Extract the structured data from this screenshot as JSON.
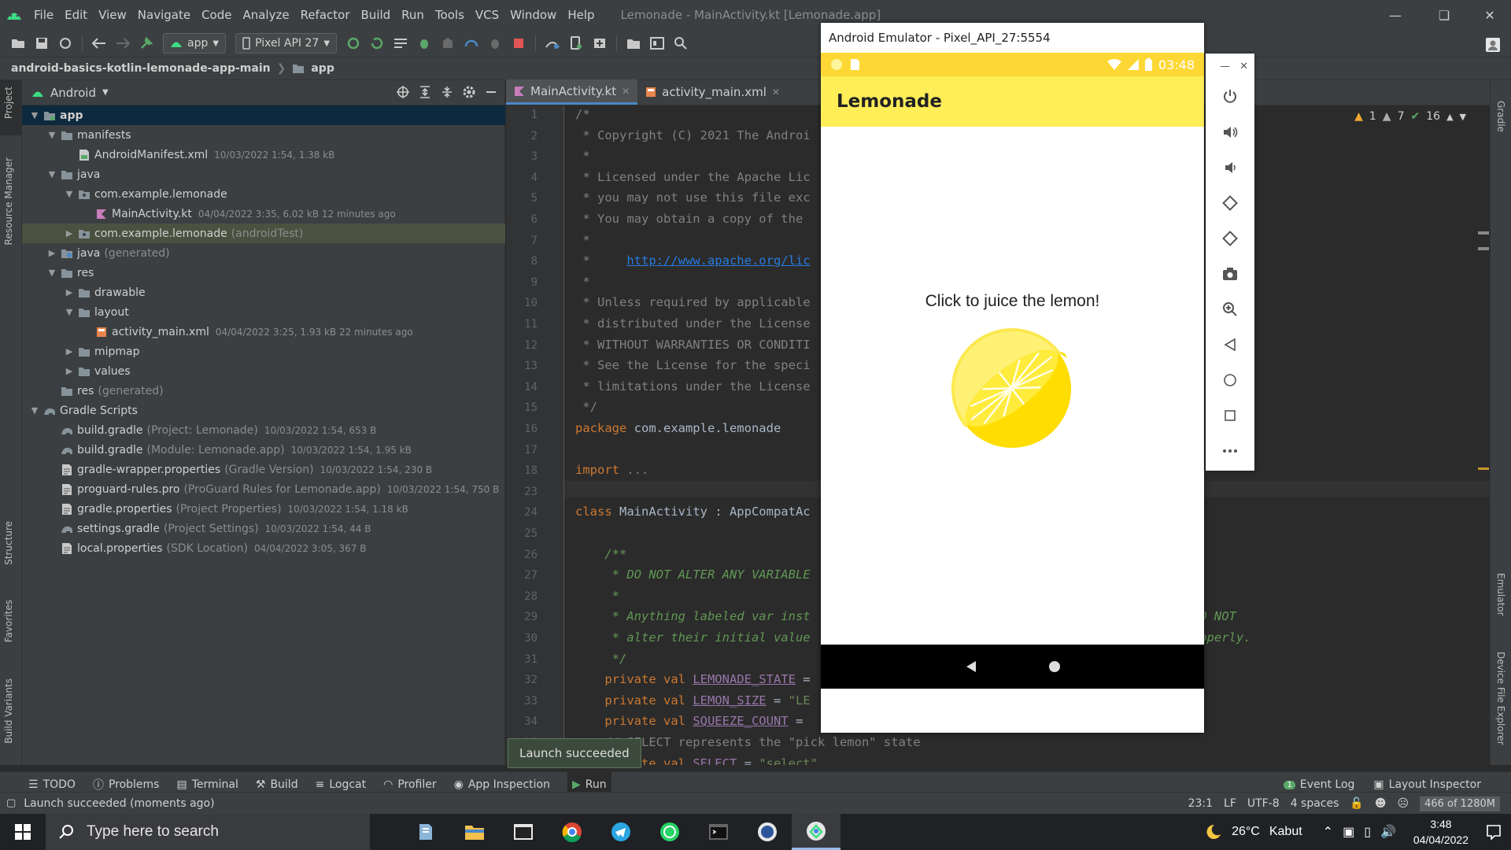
{
  "menubar": {
    "items": [
      "File",
      "Edit",
      "View",
      "Navigate",
      "Code",
      "Analyze",
      "Refactor",
      "Build",
      "Run",
      "Tools",
      "VCS",
      "Window",
      "Help"
    ],
    "window_title": "Lemonade - MainActivity.kt [Lemonade.app]"
  },
  "toolbar": {
    "run_config": "app",
    "device": "Pixel API 27"
  },
  "breadcrumb": {
    "project": "android-basics-kotlin-lemonade-app-main",
    "module": "app"
  },
  "left_strip": {
    "tabs": [
      "Project",
      "Resource Manager",
      "Structure",
      "Favorites",
      "Build Variants"
    ]
  },
  "project_panel": {
    "view": "Android",
    "tree": [
      {
        "depth": 0,
        "arrow": "open",
        "icon": "module-folder-icon",
        "label": "app",
        "bold": true,
        "selected": true
      },
      {
        "depth": 1,
        "arrow": "open",
        "icon": "folder-icon",
        "label": "manifests"
      },
      {
        "depth": 2,
        "arrow": "",
        "icon": "manifest-file-icon",
        "label": "AndroidManifest.xml",
        "meta": "10/03/2022 1:54, 1.38 kB"
      },
      {
        "depth": 1,
        "arrow": "open",
        "icon": "folder-icon",
        "label": "java"
      },
      {
        "depth": 2,
        "arrow": "open",
        "icon": "package-icon",
        "label": "com.example.lemonade"
      },
      {
        "depth": 3,
        "arrow": "",
        "icon": "kotlin-file-icon",
        "label": "MainActivity.kt",
        "meta": "04/04/2022 3:35, 6.02 kB 12 minutes ago"
      },
      {
        "depth": 2,
        "arrow": "closed",
        "icon": "package-icon",
        "label": "com.example.lemonade",
        "gray": "(androidTest)",
        "highlight": true
      },
      {
        "depth": 1,
        "arrow": "closed",
        "icon": "generated-folder-icon",
        "label": "java",
        "gray": "(generated)"
      },
      {
        "depth": 1,
        "arrow": "open",
        "icon": "folder-icon",
        "label": "res"
      },
      {
        "depth": 2,
        "arrow": "closed",
        "icon": "folder-icon",
        "label": "drawable"
      },
      {
        "depth": 2,
        "arrow": "open",
        "icon": "folder-icon",
        "label": "layout"
      },
      {
        "depth": 3,
        "arrow": "",
        "icon": "layout-file-icon",
        "label": "activity_main.xml",
        "meta": "04/04/2022 3:25, 1.93 kB 22 minutes ago"
      },
      {
        "depth": 2,
        "arrow": "closed",
        "icon": "folder-icon",
        "label": "mipmap"
      },
      {
        "depth": 2,
        "arrow": "closed",
        "icon": "folder-icon",
        "label": "values"
      },
      {
        "depth": 1,
        "arrow": "",
        "icon": "folder-icon",
        "label": "res",
        "gray": "(generated)"
      },
      {
        "depth": 0,
        "arrow": "open",
        "icon": "gradle-icon",
        "label": "Gradle Scripts"
      },
      {
        "depth": 1,
        "arrow": "",
        "icon": "gradle-icon",
        "label": "build.gradle",
        "gray": "(Project: Lemonade)",
        "meta": "10/03/2022 1:54, 653 B"
      },
      {
        "depth": 1,
        "arrow": "",
        "icon": "gradle-icon",
        "label": "build.gradle",
        "gray": "(Module: Lemonade.app)",
        "meta": "10/03/2022 1:54, 1.95 kB"
      },
      {
        "depth": 1,
        "arrow": "",
        "icon": "properties-icon",
        "label": "gradle-wrapper.properties",
        "gray": "(Gradle Version)",
        "meta": "10/03/2022 1:54, 230 B"
      },
      {
        "depth": 1,
        "arrow": "",
        "icon": "properties-icon",
        "label": "proguard-rules.pro",
        "gray": "(ProGuard Rules for Lemonade.app)",
        "meta": "10/03/2022 1:54, 750 B"
      },
      {
        "depth": 1,
        "arrow": "",
        "icon": "properties-icon",
        "label": "gradle.properties",
        "gray": "(Project Properties)",
        "meta": "10/03/2022 1:54, 1.18 kB"
      },
      {
        "depth": 1,
        "arrow": "",
        "icon": "gradle-icon",
        "label": "settings.gradle",
        "gray": "(Project Settings)",
        "meta": "10/03/2022 1:54, 44 B"
      },
      {
        "depth": 1,
        "arrow": "",
        "icon": "properties-icon",
        "label": "local.properties",
        "gray": "(SDK Location)",
        "meta": "04/04/2022 3:05, 367 B"
      }
    ]
  },
  "editor": {
    "tabs": [
      {
        "label": "MainActivity.kt",
        "active": true
      },
      {
        "label": "activity_main.xml",
        "active": false
      }
    ],
    "inspection": {
      "warnings": "1",
      "weak_warnings": "7",
      "ok": "16"
    },
    "lines": [
      {
        "n": "1",
        "parts": [
          {
            "t": "/*",
            "c": "cmt"
          }
        ]
      },
      {
        "n": "2",
        "parts": [
          {
            "t": " * Copyright (C) 2021 The Androi",
            "c": "cmt"
          }
        ]
      },
      {
        "n": "3",
        "parts": [
          {
            "t": " *",
            "c": "cmt"
          }
        ]
      },
      {
        "n": "4",
        "parts": [
          {
            "t": " * Licensed under the Apache Lic",
            "c": "cmt"
          }
        ]
      },
      {
        "n": "5",
        "parts": [
          {
            "t": " * you may not use this file exc",
            "c": "cmt"
          }
        ]
      },
      {
        "n": "6",
        "parts": [
          {
            "t": " * You may obtain a copy of the ",
            "c": "cmt"
          }
        ]
      },
      {
        "n": "7",
        "parts": [
          {
            "t": " *",
            "c": "cmt"
          }
        ]
      },
      {
        "n": "8",
        "parts": [
          {
            "t": " *     ",
            "c": "cmt"
          },
          {
            "t": "http://www.apache.org/lic",
            "c": "link"
          }
        ]
      },
      {
        "n": "9",
        "parts": [
          {
            "t": " *",
            "c": "cmt"
          }
        ]
      },
      {
        "n": "10",
        "parts": [
          {
            "t": " * Unless required by applicable",
            "c": "cmt"
          }
        ]
      },
      {
        "n": "11",
        "parts": [
          {
            "t": " * distributed under the License",
            "c": "cmt"
          }
        ]
      },
      {
        "n": "12",
        "parts": [
          {
            "t": " * WITHOUT WARRANTIES OR CONDITI",
            "c": "cmt"
          }
        ]
      },
      {
        "n": "13",
        "parts": [
          {
            "t": " * See the License for the speci",
            "c": "cmt"
          }
        ]
      },
      {
        "n": "14",
        "parts": [
          {
            "t": " * limitations under the License",
            "c": "cmt"
          }
        ]
      },
      {
        "n": "15",
        "parts": [
          {
            "t": " */",
            "c": "cmt"
          }
        ]
      },
      {
        "n": "16",
        "parts": [
          {
            "t": "package ",
            "c": "kw"
          },
          {
            "t": "com.example.lemonade",
            "c": ""
          }
        ]
      },
      {
        "n": "17",
        "parts": []
      },
      {
        "n": "18",
        "parts": [
          {
            "t": "import ",
            "c": "kw"
          },
          {
            "t": "...",
            "c": "cmt"
          }
        ]
      },
      {
        "n": "23",
        "parts": []
      },
      {
        "n": "24",
        "parts": [
          {
            "t": "class ",
            "c": "kw"
          },
          {
            "t": "MainActivity : AppCompatAc",
            "c": ""
          }
        ]
      },
      {
        "n": "25",
        "parts": []
      },
      {
        "n": "26",
        "parts": [
          {
            "t": "    /**",
            "c": "doc"
          }
        ]
      },
      {
        "n": "27",
        "parts": [
          {
            "t": "     * DO NOT ALTER ANY VARIABLE",
            "c": "doc"
          }
        ]
      },
      {
        "n": "28",
        "parts": [
          {
            "t": "     *",
            "c": "doc"
          }
        ]
      },
      {
        "n": "29",
        "parts": [
          {
            "t": "     * Anything labeled var inst",
            "c": "doc"
          },
          {
            "t": "                                          tions but DO NOT",
            "c": "doc"
          }
        ]
      },
      {
        "n": "30",
        "parts": [
          {
            "t": "     * alter their initial value",
            "c": "doc"
          },
          {
            "t": "                                          function properly.",
            "c": "doc"
          }
        ]
      },
      {
        "n": "31",
        "parts": [
          {
            "t": "     */",
            "c": "doc"
          }
        ]
      },
      {
        "n": "32",
        "parts": [
          {
            "t": "    private val ",
            "c": "kw"
          },
          {
            "t": "LEMONADE_STATE",
            "c": "fld"
          },
          {
            "t": " =",
            "c": ""
          }
        ]
      },
      {
        "n": "33",
        "parts": [
          {
            "t": "    private val ",
            "c": "kw"
          },
          {
            "t": "LEMON_SIZE",
            "c": "fld"
          },
          {
            "t": " = ",
            "c": ""
          },
          {
            "t": "\"LE",
            "c": "str"
          }
        ]
      },
      {
        "n": "34",
        "parts": [
          {
            "t": "    private val ",
            "c": "kw"
          },
          {
            "t": "SQUEEZE_COUNT",
            "c": "fld"
          },
          {
            "t": " =",
            "c": ""
          }
        ]
      },
      {
        "n": "35",
        "parts": [
          {
            "t": "    // SELECT represents the \"pick lemon\" state",
            "c": "cmt"
          }
        ]
      },
      {
        "n": "36",
        "parts": [
          {
            "t": "    private val ",
            "c": "kw"
          },
          {
            "t": "SELECT",
            "c": "fld"
          },
          {
            "t": " = ",
            "c": ""
          },
          {
            "t": "\"select\"",
            "c": "str"
          }
        ]
      }
    ]
  },
  "right_strip": {
    "tabs": [
      "Gradle",
      "Emulator",
      "Device File Explorer"
    ]
  },
  "toast": "Launch succeeded",
  "bottom_tools": {
    "left": [
      "TODO",
      "Problems",
      "Terminal",
      "Build",
      "Logcat",
      "Profiler",
      "App Inspection",
      "Run"
    ],
    "event_log": "Event Log",
    "event_count": "1",
    "layout_inspector": "Layout Inspector"
  },
  "status": {
    "message": "Launch succeeded (moments ago)",
    "position": "23:1",
    "line_sep": "LF",
    "encoding": "UTF-8",
    "indent": "4 spaces",
    "memory": "466 of 1280M"
  },
  "emulator": {
    "title": "Android Emulator - Pixel_API_27:5554",
    "time": "03:48",
    "app_title": "Lemonade",
    "prompt": "Click to juice the lemon!"
  },
  "taskbar": {
    "search_placeholder": "Type here to search",
    "weather_temp": "26°C",
    "weather_text": "Kabut",
    "time": "3:48",
    "date": "04/04/2022"
  }
}
